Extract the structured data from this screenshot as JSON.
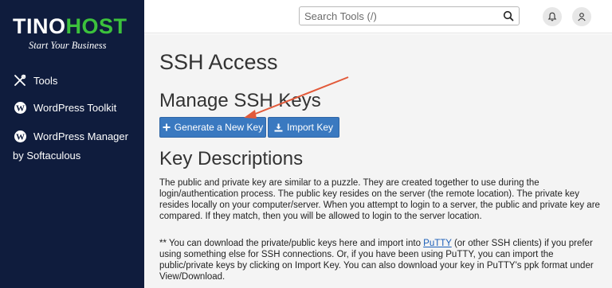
{
  "brand": {
    "name_part1": "TINO",
    "name_part2": "HOST",
    "tagline": "Start Your Business",
    "accent_color": "#3cc23c"
  },
  "sidebar": {
    "items": [
      {
        "label": "Tools",
        "icon": "tools-icon"
      },
      {
        "label": "WordPress Toolkit",
        "icon": "wordpress-icon"
      },
      {
        "label": "WordPress Manager",
        "icon": "wordpress-icon"
      }
    ],
    "item3_continuation": "by Softaculous"
  },
  "topbar": {
    "search_placeholder": "Search Tools (/)",
    "icons": [
      "search-icon",
      "bell-icon",
      "user-icon"
    ]
  },
  "page": {
    "title": "SSH Access",
    "manage_heading": "Manage SSH Keys",
    "generate_button": "Generate a New Key",
    "import_button": "Import Key",
    "desc_heading": "Key Descriptions",
    "para1": "The public and private key are similar to a puzzle. They are created together to use during the login/authentication process. The public key resides on the server (the remote location). The private key resides locally on your computer/server. When you attempt to login to a server, the public and private key are compared. If they match, then you will be allowed to login to the server location.",
    "para2_before_link": "** You can download the private/public keys here and import into ",
    "para2_link": "PuTTY",
    "para2_after_link": " (or other SSH clients) if you prefer using something else for SSH connections. Or, if you have been using PuTTY, you can import the public/private keys by clicking on Import Key. You can also download your key in PuTTY's ppk format under View/Download."
  },
  "colors": {
    "sidebar_bg": "#0f1c3d",
    "button_bg": "#3a79c0",
    "annotation_arrow": "#e25a3a"
  }
}
